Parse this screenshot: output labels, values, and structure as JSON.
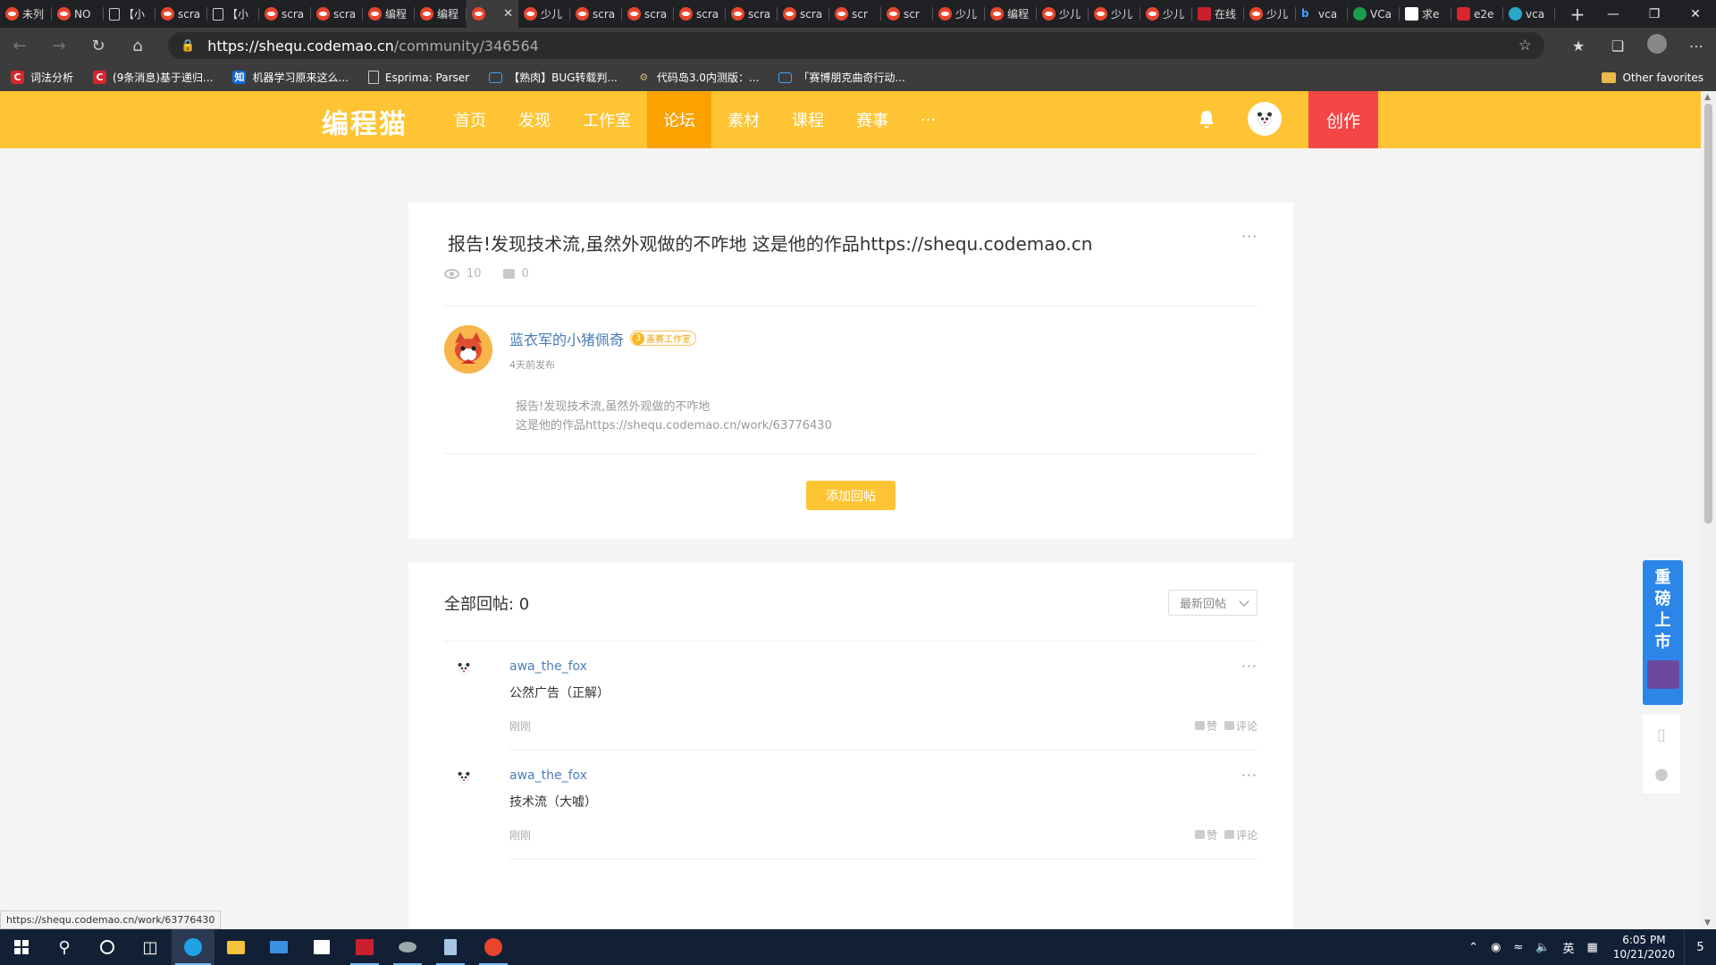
{
  "browser": {
    "tabs": [
      {
        "label": "未列",
        "icon": "codemao-icon"
      },
      {
        "label": "NO",
        "icon": "codemao-icon"
      },
      {
        "label": "【小",
        "icon": "page-icon"
      },
      {
        "label": "scra",
        "icon": "codemao-icon"
      },
      {
        "label": "【小",
        "icon": "page-icon"
      },
      {
        "label": "scra",
        "icon": "codemao-icon"
      },
      {
        "label": "scra",
        "icon": "codemao-icon"
      },
      {
        "label": "编程",
        "icon": "codemao-icon"
      },
      {
        "label": "编程",
        "icon": "codemao-icon"
      },
      {
        "label": "",
        "icon": "codemao-icon",
        "active": true
      },
      {
        "label": "少儿",
        "icon": "codemao-icon"
      },
      {
        "label": "scra",
        "icon": "codemao-icon"
      },
      {
        "label": "scra",
        "icon": "codemao-icon"
      },
      {
        "label": "scra",
        "icon": "codemao-icon"
      },
      {
        "label": "scra",
        "icon": "codemao-icon"
      },
      {
        "label": "scra",
        "icon": "codemao-icon"
      },
      {
        "label": "scr",
        "icon": "codemao-icon"
      },
      {
        "label": "scr",
        "icon": "codemao-icon"
      },
      {
        "label": "少儿",
        "icon": "codemao-icon"
      },
      {
        "label": "编程",
        "icon": "codemao-icon"
      },
      {
        "label": "少儿",
        "icon": "codemao-icon"
      },
      {
        "label": "少儿",
        "icon": "codemao-icon"
      },
      {
        "label": "少儿",
        "icon": "codemao-icon"
      },
      {
        "label": "在线",
        "icon": "red-icon"
      },
      {
        "label": "少儿",
        "icon": "codemao-icon"
      },
      {
        "label": "vca",
        "icon": "bing-icon"
      },
      {
        "label": "VCa",
        "icon": "green-icon"
      },
      {
        "label": "求e",
        "icon": "z-icon"
      },
      {
        "label": "e2e",
        "icon": "c-icon"
      },
      {
        "label": "vca",
        "icon": "cyan-icon"
      }
    ],
    "url_host": "https://shequ.codemao.cn",
    "url_path": "/community/346564",
    "bookmarks": [
      {
        "label": "词法分析",
        "icon": "c"
      },
      {
        "label": "(9条消息)基于递归...",
        "icon": "c"
      },
      {
        "label": "机器学习原来这么...",
        "icon": "zhi"
      },
      {
        "label": "Esprima: Parser",
        "icon": "doc"
      },
      {
        "label": "【熟肉】BUG转载判...",
        "icon": "tv"
      },
      {
        "label": "代码岛3.0内测版：...",
        "icon": "gear"
      },
      {
        "label": "「赛博朋克曲奇行动...",
        "icon": "tv"
      }
    ],
    "other_favorites": "Other favorites",
    "status_url": "https://shequ.codemao.cn/work/63776430"
  },
  "site": {
    "logo": "编程猫",
    "nav": [
      "首页",
      "发现",
      "工作室",
      "论坛",
      "素材",
      "课程",
      "赛事",
      "···"
    ],
    "active_nav": "论坛",
    "create_label": "创作",
    "brand_color": "#fec433",
    "active_color": "#f9a200",
    "create_color": "#f44646"
  },
  "post": {
    "title": "报告!发现技术流,虽然外观做的不咋地 这是他的作品https://shequ.codemao.cn",
    "views": "10",
    "comments": "0",
    "author": "蓝衣军的小猪佩奇",
    "badge_level": "3",
    "badge_label": "盖赛工作室",
    "time": "4天前发布",
    "body_line1": "报告!发现技术流,虽然外观做的不咋地",
    "body_line2": "这是他的作品https://shequ.codemao.cn/work/63776430",
    "reply_button": "添加回帖"
  },
  "replies": {
    "title": "全部回帖: 0",
    "sort": "最新回帖",
    "items": [
      {
        "name": "awa_the_fox",
        "text": "公然广告（正解）",
        "time": "刚刚",
        "like": "赞",
        "comment": "评论"
      },
      {
        "name": "awa_the_fox",
        "text": "技术流（大嘘）",
        "time": "刚刚",
        "like": "赞",
        "comment": "评论"
      }
    ]
  },
  "promo": {
    "text": [
      "重",
      "磅",
      "上",
      "市"
    ]
  },
  "taskbar": {
    "time": "6:05 PM",
    "date": "10/21/2020",
    "ime": "英",
    "notifications": "5"
  }
}
